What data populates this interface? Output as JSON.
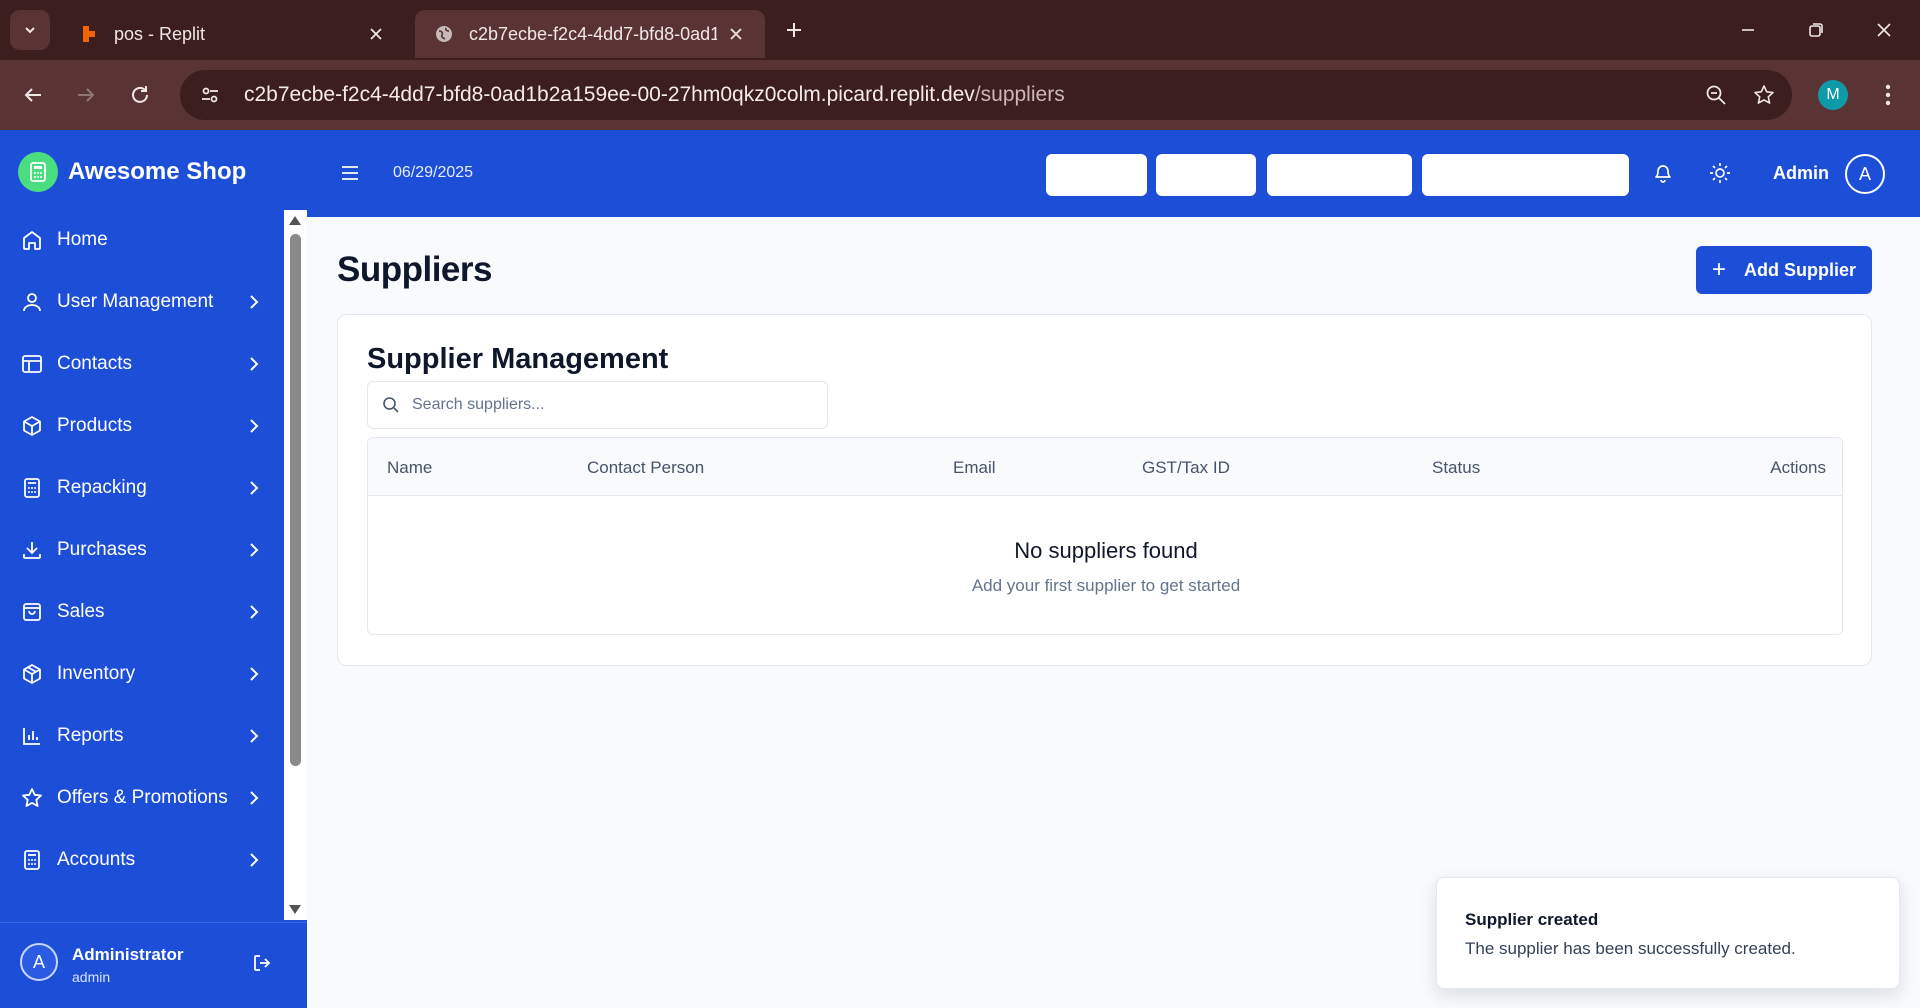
{
  "browser": {
    "tabs": [
      {
        "title": "pos - Replit",
        "icon": "replit-icon"
      },
      {
        "title": "c2b7ecbe-f2c4-4dd7-bfd8-0ad1",
        "icon": "globe-icon"
      }
    ],
    "url_host": "c2b7ecbe-f2c4-4dd7-bfd8-0ad1b2a159ee-00-27hm0qkz0colm.picard.replit.dev",
    "url_path": "/suppliers",
    "profile_initial": "M",
    "profile_color": "#0e9aa7"
  },
  "app": {
    "brand": "Awesome Shop",
    "brand_color": "#1d4ed8",
    "date": "06/29/2025",
    "user_name": "Admin",
    "user_initial": "A"
  },
  "sidebar": {
    "items": [
      {
        "label": "Home",
        "icon": "home-icon",
        "has_children": false
      },
      {
        "label": "User Management",
        "icon": "user-icon",
        "has_children": true
      },
      {
        "label": "Contacts",
        "icon": "contacts-icon",
        "has_children": true
      },
      {
        "label": "Products",
        "icon": "box-icon",
        "has_children": true
      },
      {
        "label": "Repacking",
        "icon": "calculator-icon",
        "has_children": true
      },
      {
        "label": "Purchases",
        "icon": "download-icon",
        "has_children": true
      },
      {
        "label": "Sales",
        "icon": "shopping-bag-icon",
        "has_children": true
      },
      {
        "label": "Inventory",
        "icon": "package-icon",
        "has_children": true
      },
      {
        "label": "Reports",
        "icon": "bar-chart-icon",
        "has_children": true
      },
      {
        "label": "Offers & Promotions",
        "icon": "star-icon",
        "has_children": true
      },
      {
        "label": "Accounts",
        "icon": "ledger-icon",
        "has_children": true
      }
    ],
    "footer": {
      "name": "Administrator",
      "role": "admin",
      "initial": "A"
    }
  },
  "main": {
    "title": "Suppliers",
    "add_button": "Add Supplier",
    "card_title": "Supplier Management",
    "search_placeholder": "Search suppliers...",
    "columns": [
      "Name",
      "Contact Person",
      "Email",
      "GST/Tax ID",
      "Status",
      "Actions"
    ],
    "empty_title": "No suppliers found",
    "empty_subtitle": "Add your first supplier to get started"
  },
  "toast": {
    "title": "Supplier created",
    "description": "The supplier has been successfully created."
  }
}
